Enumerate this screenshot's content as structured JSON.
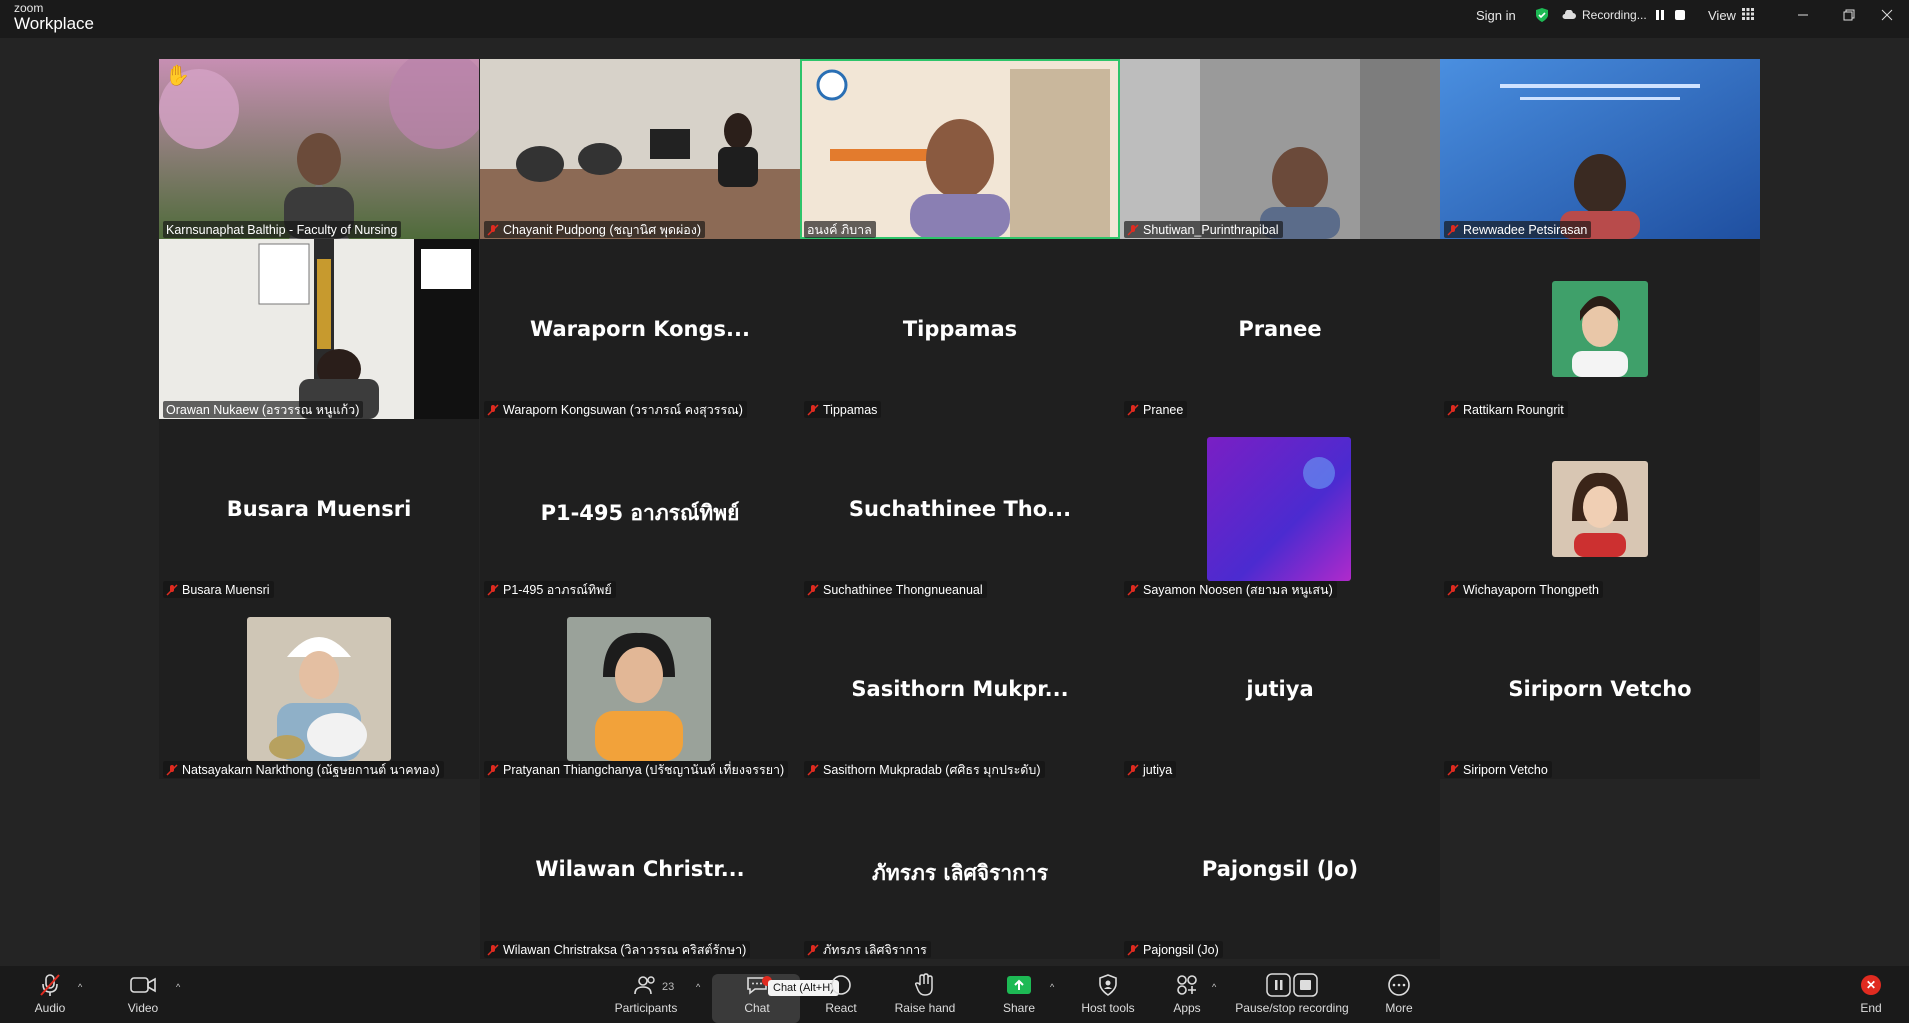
{
  "app": {
    "logo_small": "zoom",
    "logo_big": "Workplace"
  },
  "titlebar": {
    "sign_in": "Sign in",
    "recording_label": "Recording...",
    "view_label": "View",
    "window_controls": [
      "minimize-icon",
      "restore-icon",
      "close-icon"
    ]
  },
  "participants": [
    {
      "name": "Karnsunaphat Balthip - Faculty of Nursing",
      "display": "",
      "muted": false,
      "kind": "video",
      "raised_hand": true
    },
    {
      "name": "Chayanit Pudpong (ชญานิศ พุดผ่อง)",
      "display": "",
      "muted": true,
      "kind": "video"
    },
    {
      "name": "อนงค์ ภิบาล",
      "display": "",
      "muted": false,
      "kind": "video",
      "active_speaker": true
    },
    {
      "name": "Shutiwan_Purinthrapibal",
      "display": "",
      "muted": true,
      "kind": "video"
    },
    {
      "name": "Rewwadee Petsirasan",
      "display": "",
      "muted": true,
      "kind": "video"
    },
    {
      "name": "Orawan Nukaew (อรวรรณ หนูแก้ว)",
      "display": "",
      "muted": false,
      "kind": "video"
    },
    {
      "name": "Waraporn Kongsuwan (วราภรณ์ คงสุวรรณ)",
      "display": "Waraporn  Kongs...",
      "muted": true,
      "kind": "name"
    },
    {
      "name": "Tippamas",
      "display": "Tippamas",
      "muted": true,
      "kind": "name"
    },
    {
      "name": "Pranee",
      "display": "Pranee",
      "muted": true,
      "kind": "name"
    },
    {
      "name": "Rattikarn Roungrit",
      "display": "",
      "muted": true,
      "kind": "avatar"
    },
    {
      "name": "Busara Muensri",
      "display": "Busara Muensri",
      "muted": true,
      "kind": "name"
    },
    {
      "name": "P1-495 อาภรณ์ทิพย์",
      "display": "P1-495 อาภรณ์ทิพย์",
      "muted": true,
      "kind": "name"
    },
    {
      "name": "Suchathinee Thongnueanual",
      "display": "Suchathinee  Tho...",
      "muted": true,
      "kind": "name"
    },
    {
      "name": "Sayamon Noosen (สยามล หนูเสน)",
      "display": "",
      "muted": true,
      "kind": "avatar"
    },
    {
      "name": "Wichayaporn Thongpeth",
      "display": "",
      "muted": true,
      "kind": "avatar"
    },
    {
      "name": "Natsayakarn Narkthong (ณัฐษยกานต์ นาคทอง)",
      "display": "",
      "muted": true,
      "kind": "avatar"
    },
    {
      "name": "Pratyanan Thiangchanya (ปรัชญานันท์ เที่ยงจรรยา)",
      "display": "",
      "muted": true,
      "kind": "avatar"
    },
    {
      "name": "Sasithorn Mukpradab (ศศิธร มุกประดับ)",
      "display": "Sasithorn  Mukpr...",
      "muted": true,
      "kind": "name"
    },
    {
      "name": "jutiya",
      "display": "jutiya",
      "muted": true,
      "kind": "name"
    },
    {
      "name": "Siriporn Vetcho",
      "display": "Siriporn Vetcho",
      "muted": true,
      "kind": "name"
    },
    {
      "name": "Wilawan Christraksa (วิลาวรรณ คริสต์รักษา)",
      "display": "Wilawan  Christr...",
      "muted": true,
      "kind": "name"
    },
    {
      "name": "ภัทรภร เลิศจิราการ",
      "display": "ภัทรภร เลิศจิราการ",
      "muted": true,
      "kind": "name"
    },
    {
      "name": "Pajongsil (Jo)",
      "display": "Pajongsil (Jo)",
      "muted": true,
      "kind": "name"
    }
  ],
  "toolbar": {
    "audio": "Audio",
    "video": "Video",
    "participants": "Participants",
    "participants_count": "23",
    "chat": "Chat",
    "chat_tooltip": "Chat (Alt+H)",
    "react": "React",
    "raise_hand": "Raise hand",
    "share": "Share",
    "host_tools": "Host tools",
    "apps": "Apps",
    "pause_stop_recording": "Pause/stop recording",
    "more": "More",
    "end": "End"
  },
  "colors": {
    "active_speaker": "#2ec46a",
    "share_green": "#1db954",
    "end_red": "#e02b20",
    "mute_red": "#e02b20"
  }
}
